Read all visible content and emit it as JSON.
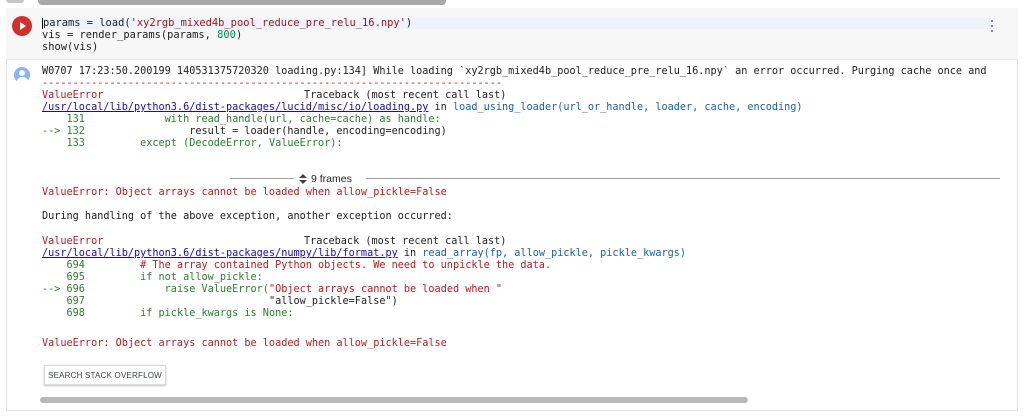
{
  "cell": {
    "code_lines": {
      "l1_prefix": "params = load(",
      "l1_string": "'xy2rgb_mixed4b_pool_reduce_pre_relu_16.npy'",
      "l1_suffix": ")",
      "l2_prefix": "vis = render_params(params, ",
      "l2_number": "800",
      "l2_suffix": ")",
      "l3": "show(vis)"
    }
  },
  "output": {
    "warning": "W0707 17:23:50.200199 140531375720320 loading.py:134] While loading `xy2rgb_mixed4b_pool_reduce_pre_relu_16.npy` an error occurred. Purging cache once and",
    "separator": "---------------------------------------------------------------------------",
    "tb1": {
      "error_name": "ValueError",
      "header_right": "Traceback (most recent call last)",
      "file_link": "/usr/local/lib/python3.6/dist-packages/lucid/misc/io/loading.py",
      "in_word": " in ",
      "func_sig": "load_using_loader(url_or_handle, loader, cache, encoding)",
      "lines": [
        {
          "prefix": "    131",
          "code_kw": "",
          "code": "             with read_handle(url, cache=cache) as handle:"
        },
        {
          "prefix": "--> 132",
          "code_kw": "",
          "code": "                 result = loader(handle, encoding=encoding)"
        },
        {
          "prefix": "    133",
          "code_kw": "",
          "code": "         except (DecodeError, ValueError):"
        }
      ]
    },
    "frames_label": "9 frames",
    "error_msg_1": "ValueError: Object arrays cannot be loaded when allow_pickle=False",
    "during_handling": "During handling of the above exception, another exception occurred:",
    "tb2": {
      "error_name": "ValueError",
      "header_right": "Traceback (most recent call last)",
      "file_link": "/usr/local/lib/python3.6/dist-packages/numpy/lib/format.py",
      "in_word": " in ",
      "func_sig": "read_array(fp, allow_pickle, pickle_kwargs)",
      "l694_no": "    694",
      "l694_code": "         # The array contained Python objects. We need to unpickle the data.",
      "l695_no": "    695",
      "l695_code": "         if not allow_pickle:",
      "l696_no": "--> 696",
      "l696_code_a": "             raise ValueError(",
      "l696_code_b": "\"Object arrays cannot be loaded when \"",
      "l697_no": "    697",
      "l697_code": "                              \"allow_pickle=False\")",
      "l698_no": "    698",
      "l698_code": "         if pickle_kwargs is None:"
    },
    "error_msg_2": "ValueError: Object arrays cannot be loaded when allow_pickle=False"
  },
  "buttons": {
    "search_stack_overflow": "SEARCH STACK OVERFLOW"
  }
}
